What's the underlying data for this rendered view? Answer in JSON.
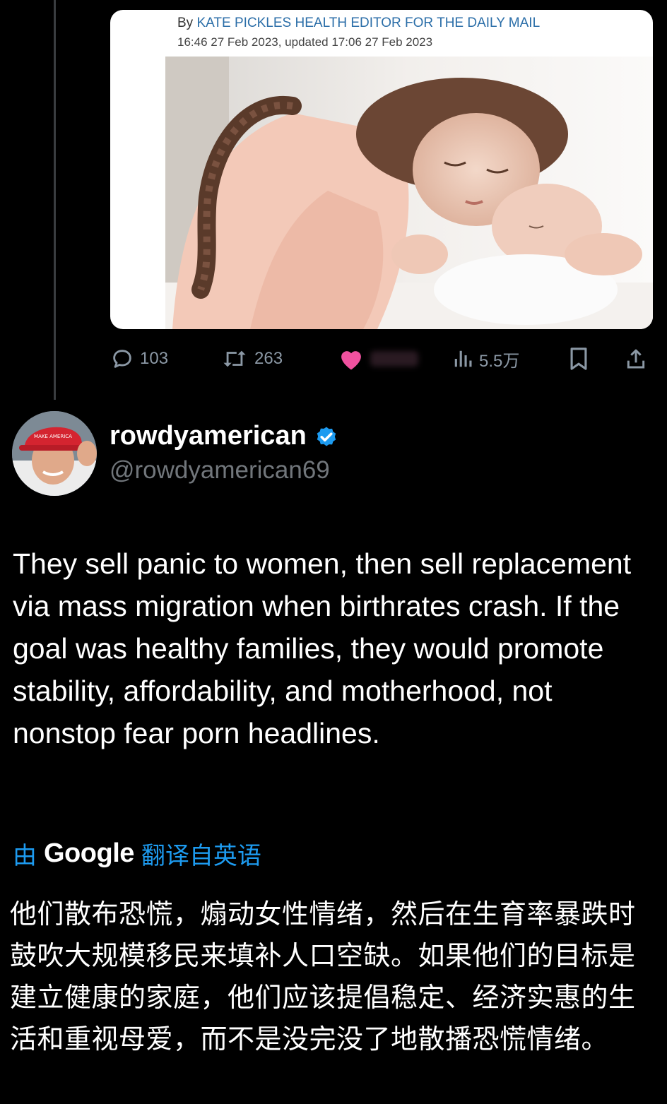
{
  "article": {
    "byline_prefix": "By",
    "author": "KATE PICKLES HEALTH EDITOR FOR THE DAILY MAIL",
    "timestamp": "16:46 27 Feb 2023, updated 17:06 27 Feb 2023",
    "image_alt": "mother-sleeping-with-newborn-photo"
  },
  "actions": {
    "replies": "103",
    "retweets": "263",
    "views": "5.5万",
    "like_color": "#f0519f"
  },
  "author": {
    "display_name": "rowdyamerican",
    "handle": "@rowdyamerican69",
    "verified": true
  },
  "tweet": {
    "text": "They sell panic to women, then sell replacement via mass migration when birthrates crash. If the goal was healthy families, they would promote stability, affordability, and motherhood, not nonstop fear porn headlines."
  },
  "translation": {
    "prefix": "由",
    "provider": "Google",
    "suffix": "翻译自英语",
    "text": "他们散布恐慌，煽动女性情绪，然后在生育率暴跌时鼓吹大规模移民来填补人口空缺。如果他们的目标是建立健康的家庭，他们应该提倡稳定、经济实惠的生活和重视母爱，而不是没完没了地散播恐慌情绪。"
  },
  "colors": {
    "background": "#000000",
    "accent": "#1d9bf0",
    "muted": "#71767b"
  }
}
